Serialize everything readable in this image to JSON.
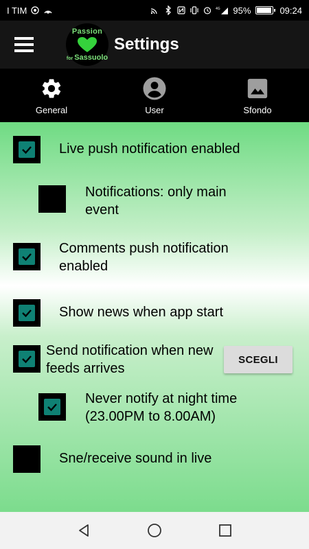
{
  "status_bar": {
    "carrier": "I TIM",
    "battery": "95%",
    "battery_level": 0.95,
    "time": "09:24",
    "network": "4G"
  },
  "toolbar": {
    "logo_top": "Passion",
    "logo_bottom_small": "for",
    "logo_bottom": "Sassuolo",
    "title": "Settings"
  },
  "tabs": [
    {
      "label": "General",
      "icon": "gear-icon"
    },
    {
      "label": "User",
      "icon": "user-icon"
    },
    {
      "label": "Sfondo",
      "icon": "image-icon"
    }
  ],
  "settings": [
    {
      "label": "Live push notification enabled",
      "checked": true
    },
    {
      "label": "Notifications: only main event",
      "checked": false
    },
    {
      "label": "Comments push notification enabled",
      "checked": true
    },
    {
      "label": "Show news when app start",
      "checked": true
    },
    {
      "label": "Send notification when new feeds arrives",
      "checked": true
    },
    {
      "label": "Never notify at night time (23.00PM to 8.00AM)",
      "checked": true
    },
    {
      "label": "Sne/receive sound in live",
      "checked": false
    }
  ],
  "scegli_button": "SCEGLI",
  "colors": {
    "accent": "#0f8174",
    "toolbar": "#151515",
    "logo_green": "#7ce07a"
  }
}
